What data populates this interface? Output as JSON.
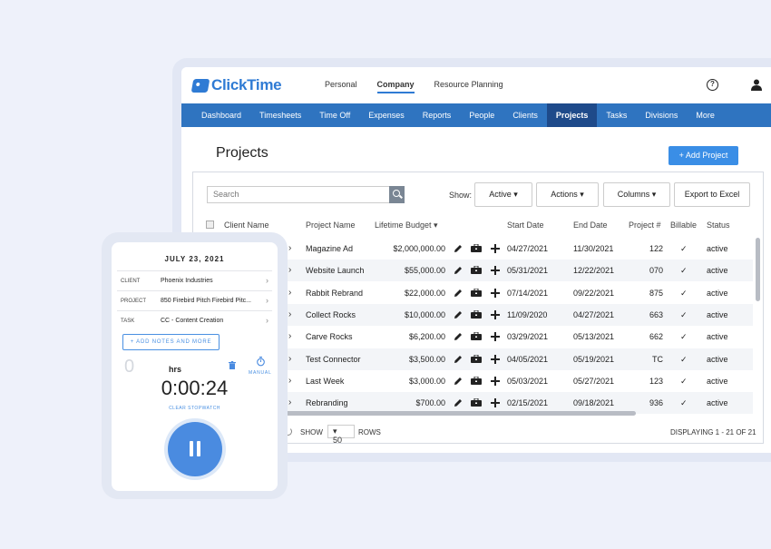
{
  "app": {
    "brand": "ClickTime",
    "top_tabs": [
      "Personal",
      "Company",
      "Resource Planning"
    ],
    "active_top_tab": "Company",
    "nav": [
      "Dashboard",
      "Timesheets",
      "Time Off",
      "Expenses",
      "Reports",
      "People",
      "Clients",
      "Projects",
      "Tasks",
      "Divisions",
      "More"
    ],
    "active_nav": "Projects",
    "icons": {
      "help": "help-circle-icon",
      "user": "user-icon"
    }
  },
  "projects": {
    "title": "Projects",
    "add_label": "+ Add Project",
    "search_placeholder": "Search",
    "show_label": "Show:",
    "filter_active": "Active",
    "actions_label": "Actions",
    "columns_label": "Columns",
    "export_label": "Export to Excel",
    "headers": [
      "Client Name",
      "Project Name",
      "Lifetime Budget",
      "Start Date",
      "End Date",
      "Project #",
      "Billable",
      "Status"
    ],
    "rows": [
      {
        "name": "Magazine Ad",
        "budget": "$2,000,000.00",
        "start": "04/27/2021",
        "end": "11/30/2021",
        "num": "122",
        "billable": "✓",
        "status": "active"
      },
      {
        "name": "Website Launch",
        "budget": "$55,000.00",
        "start": "05/31/2021",
        "end": "12/22/2021",
        "num": "070",
        "billable": "✓",
        "status": "active"
      },
      {
        "name": "Rabbit Rebrand",
        "budget": "$22,000.00",
        "start": "07/14/2021",
        "end": "09/22/2021",
        "num": "875",
        "billable": "✓",
        "status": "active"
      },
      {
        "name": "Collect Rocks",
        "budget": "$10,000.00",
        "start": "11/09/2020",
        "end": "04/27/2021",
        "num": "663",
        "billable": "✓",
        "status": "active"
      },
      {
        "name": "Carve Rocks",
        "budget": "$6,200.00",
        "start": "03/29/2021",
        "end": "05/13/2021",
        "num": "662",
        "billable": "✓",
        "status": "active"
      },
      {
        "name": "Test Connector",
        "budget": "$3,500.00",
        "start": "04/05/2021",
        "end": "05/19/2021",
        "num": "TC",
        "billable": "✓",
        "status": "active"
      },
      {
        "name": "Last Week",
        "budget": "$3,000.00",
        "start": "05/03/2021",
        "end": "05/27/2021",
        "num": "123",
        "billable": "✓",
        "status": "active"
      },
      {
        "name": "Rebranding",
        "budget": "$700.00",
        "start": "02/15/2021",
        "end": "09/18/2021",
        "num": "936",
        "billable": "✓",
        "status": "active"
      }
    ],
    "footer": {
      "show": "SHOW",
      "rows_value": "50",
      "rows": "ROWS",
      "displaying": "DISPLAYING 1 - 21 OF 21"
    }
  },
  "mobile": {
    "date": "JULY 23, 2021",
    "fields": [
      {
        "label": "CLIENT",
        "value": "Phoenix Industries"
      },
      {
        "label": "PROJECT",
        "value": "850 Firebird Pitch Firebird Pitc..."
      },
      {
        "label": "TASK",
        "value": "CC - Content Creation"
      }
    ],
    "notes_button": "+ ADD NOTES AND MORE",
    "zero": "0",
    "hrs": "hrs",
    "manual": "MANUAL",
    "timer": "0:00:24",
    "clear": "CLEAR STOPWATCH"
  },
  "colors": {
    "brand": "#2f7bd4",
    "nav": "#2f74c0",
    "nav_active": "#1e4a8a",
    "button": "#3a8ee6"
  }
}
